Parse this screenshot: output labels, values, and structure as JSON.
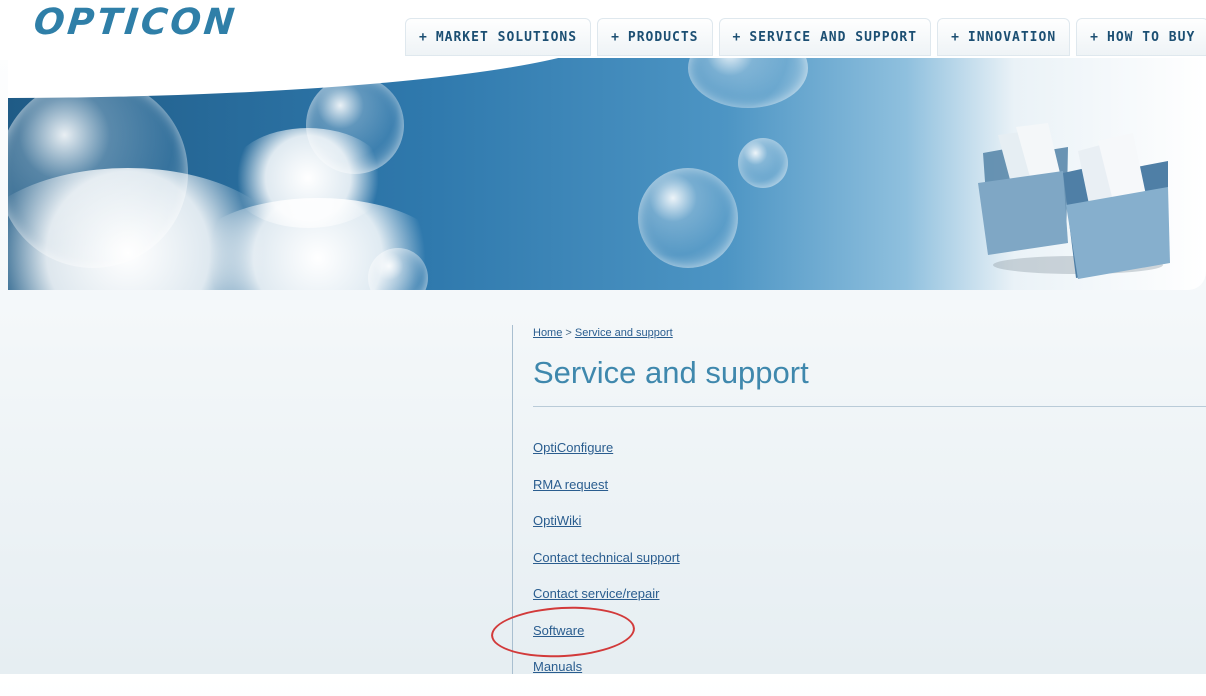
{
  "brand": {
    "logo": "OPTICON"
  },
  "nav": {
    "items": [
      {
        "label": "MARKET SOLUTIONS"
      },
      {
        "label": "PRODUCTS"
      },
      {
        "label": "SERVICE AND SUPPORT"
      },
      {
        "label": "INNOVATION"
      },
      {
        "label": "HOW TO BUY"
      }
    ]
  },
  "breadcrumb": {
    "home": "Home",
    "separator": ">",
    "current": "Service and support"
  },
  "page": {
    "title": "Service and support"
  },
  "links": [
    {
      "label": "OptiConfigure"
    },
    {
      "label": "RMA request"
    },
    {
      "label": "OptiWiki"
    },
    {
      "label": "Contact technical support"
    },
    {
      "label": "Contact service/repair"
    },
    {
      "label": "Software"
    },
    {
      "label": "Manuals"
    }
  ],
  "colors": {
    "accent": "#3f88ad",
    "link": "#2a5d8f",
    "nav_text": "#1c4f73",
    "highlight": "#d23a3a"
  }
}
